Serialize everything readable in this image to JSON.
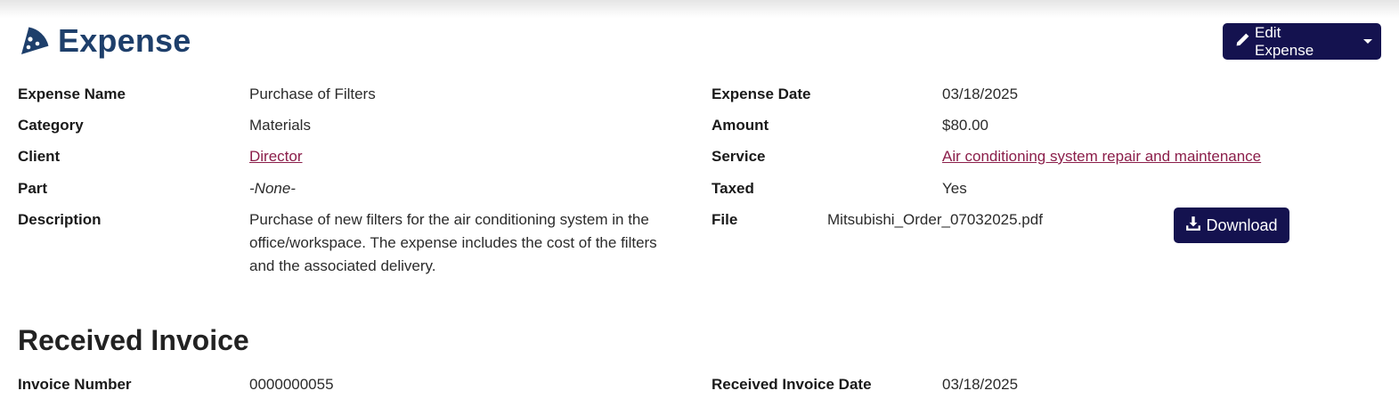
{
  "header": {
    "title": "Expense",
    "icon": "pizza-slice-icon",
    "edit_button_label": "Edit Expense",
    "accent_color": "#1e3f6b",
    "button_color": "#14124f"
  },
  "expense": {
    "name_label": "Expense Name",
    "name_value": "Purchase of Filters",
    "category_label": "Category",
    "category_value": "Materials",
    "client_label": "Client",
    "client_value": "Director",
    "part_label": "Part",
    "part_value": "-None-",
    "description_label": "Description",
    "description_value": "Purchase of new filters for the air conditioning system in the office/workspace. The expense includes the cost of the filters and the associated delivery.",
    "date_label": "Expense Date",
    "date_value": "03/18/2025",
    "amount_label": "Amount",
    "amount_value": "$80.00",
    "service_label": "Service",
    "service_value": "Air conditioning system repair and maintenance",
    "taxed_label": "Taxed",
    "taxed_value": "Yes",
    "file_label": "File",
    "file_value": "Mitsubishi_Order_07032025.pdf",
    "download_label": "Download"
  },
  "invoice": {
    "section_title": "Received Invoice",
    "number_label": "Invoice Number",
    "number_value": "0000000055",
    "date_label": "Received Invoice Date",
    "date_value": "03/18/2025"
  }
}
